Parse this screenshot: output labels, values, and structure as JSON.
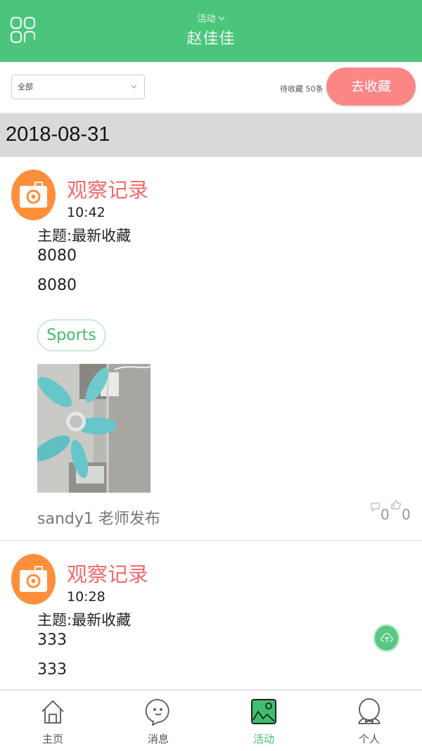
{
  "header": {
    "menu_icon": "grid-icon",
    "subtitle": "活动",
    "subtitle_icon": "chevron-down-icon",
    "title": "赵佳佳",
    "background_color": "#4cc57c"
  },
  "filter": {
    "select_value": "全部",
    "pending_text": "待收藏 50条",
    "collect_button": "去收藏",
    "collect_button_color": "#fb8686"
  },
  "date_group": "2018-08-31",
  "posts": [
    {
      "icon": "camera-icon",
      "type": "观察记录",
      "time": "10:42",
      "theme": "主题:最新收藏",
      "lines": [
        "8080",
        "8080"
      ],
      "tag": "Sports",
      "photo": "ceiling-fan-photo",
      "author": "sandy1 老师发布",
      "comments": "0",
      "likes": "0"
    },
    {
      "icon": "camera-icon",
      "type": "观察记录",
      "time": "10:28",
      "theme": "主题:最新收藏",
      "lines": [
        "333",
        "333"
      ]
    }
  ],
  "fab": {
    "icon": "cloud-upload-icon"
  },
  "tabbar": {
    "active_color": "#3fbf6d",
    "items": [
      {
        "label": "主页",
        "icon": "home-icon"
      },
      {
        "label": "消息",
        "icon": "chat-icon"
      },
      {
        "label": "活动",
        "icon": "image-icon",
        "active": true
      },
      {
        "label": "个人",
        "icon": "profile-icon"
      }
    ]
  }
}
